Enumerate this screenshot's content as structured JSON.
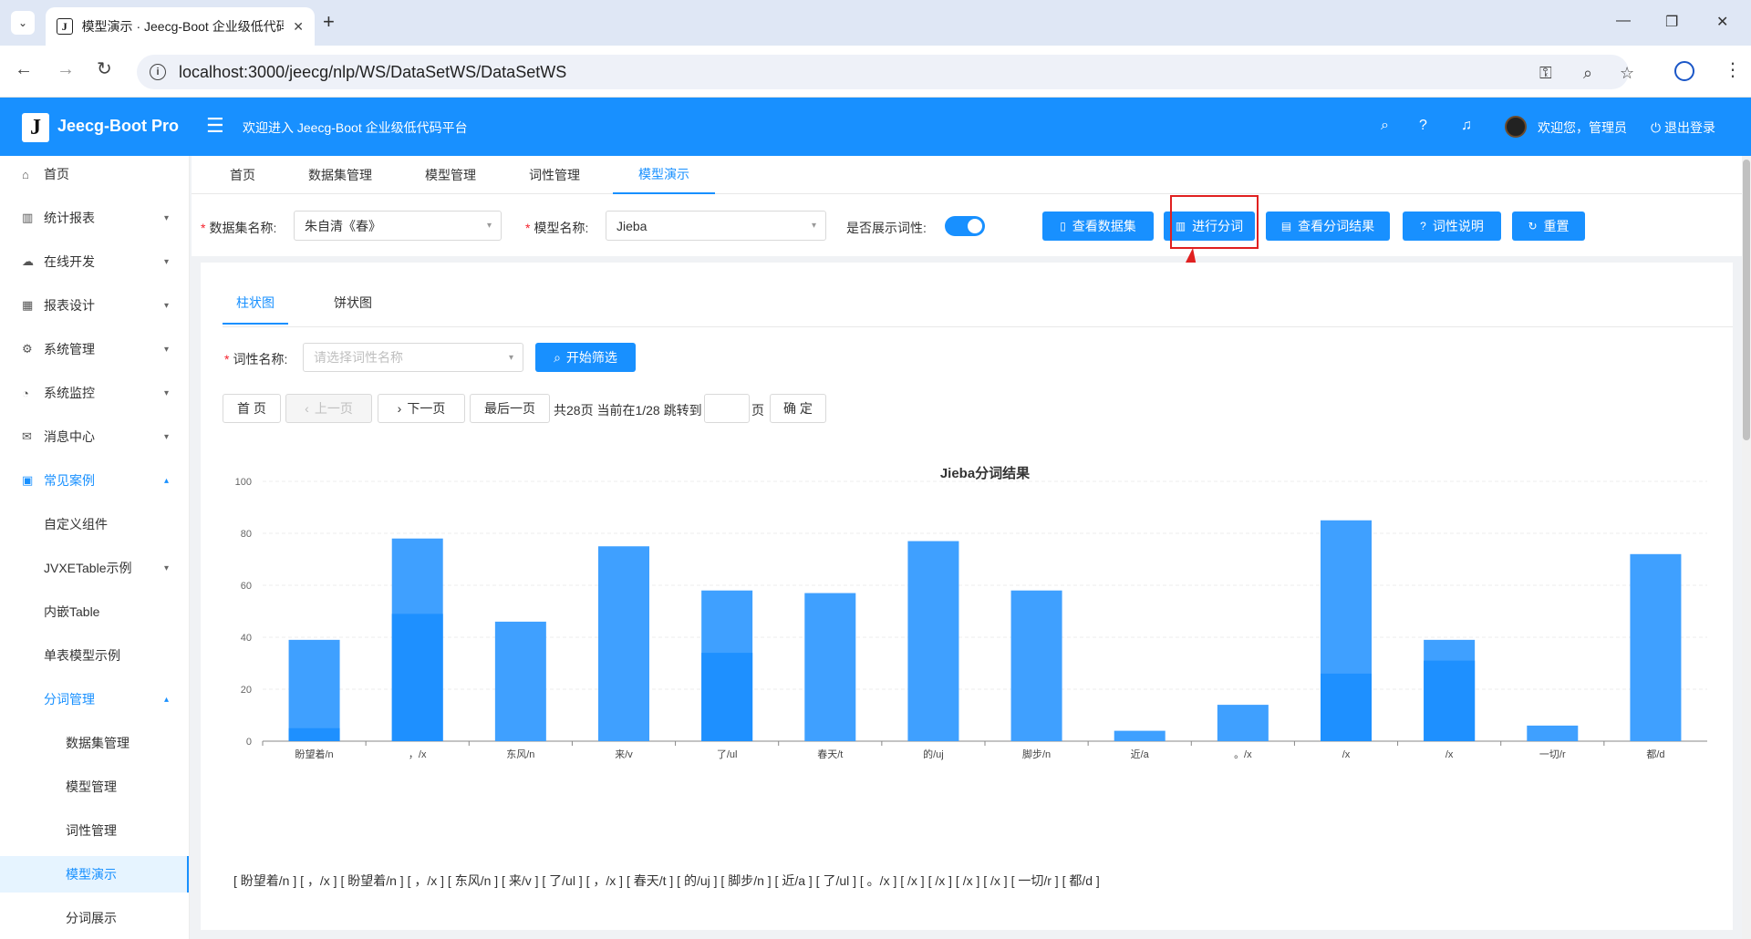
{
  "browser": {
    "tab_title": "模型演示 · Jeecg-Boot 企业级低代码平台",
    "url": "localhost:3000/jeecg/nlp/WS/DataSetWS/DataSetWS"
  },
  "header": {
    "logo_letter": "J",
    "app_name": "Jeecg-Boot Pro",
    "welcome": "欢迎进入 Jeecg-Boot 企业级低代码平台",
    "user_greeting": "欢迎您，管理员",
    "logout": "退出登录"
  },
  "sidebar": {
    "items": [
      {
        "icon": "⌂",
        "label": "首页"
      },
      {
        "icon": "▥",
        "label": "统计报表"
      },
      {
        "icon": "☁",
        "label": "在线开发"
      },
      {
        "icon": "▦",
        "label": "报表设计"
      },
      {
        "icon": "⚙",
        "label": "系统管理"
      },
      {
        "icon": "◔",
        "label": "系统监控"
      },
      {
        "icon": "✉",
        "label": "消息中心"
      },
      {
        "icon": "▣",
        "label": "常见案例"
      },
      {
        "label": "自定义组件"
      },
      {
        "label": "JVXETable示例"
      },
      {
        "label": "内嵌Table"
      },
      {
        "label": "单表模型示例"
      },
      {
        "label": "分词管理"
      },
      {
        "label": "数据集管理"
      },
      {
        "label": "模型管理"
      },
      {
        "label": "词性管理"
      },
      {
        "label": "模型演示"
      },
      {
        "label": "分词展示"
      }
    ]
  },
  "page_tabs": [
    "首页",
    "数据集管理",
    "模型管理",
    "词性管理",
    "模型演示"
  ],
  "form": {
    "dataset_label": "数据集名称:",
    "dataset_value": "朱自清《春》",
    "model_label": "模型名称:",
    "model_value": "Jieba",
    "show_pos_label": "是否展示词性:",
    "show_pos": true
  },
  "actions": [
    "查看数据集",
    "进行分词",
    "查看分词结果",
    "词性说明",
    "重置"
  ],
  "chart_tabs": [
    "柱状图",
    "饼状图"
  ],
  "filter": {
    "label": "词性名称:",
    "placeholder": "请选择词性名称",
    "button": "开始筛选"
  },
  "pagination": {
    "first": "首 页",
    "prev": "上一页",
    "next": "下一页",
    "last": "最后一页",
    "info": "共28页 当前在1/28 跳转到",
    "page_unit": "页",
    "confirm": "确 定"
  },
  "chart_data": {
    "type": "bar",
    "title": "Jieba分词结果",
    "categories": [
      "盼望着/n",
      "，/x",
      "东风/n",
      "来/v",
      "了/ul",
      "春天/t",
      "的/uj",
      "脚步/n",
      "近/a",
      "。/x",
      "/x",
      "/x",
      "一切/r",
      "都/d"
    ],
    "series": [
      {
        "values": [
          39,
          78,
          46,
          75,
          58,
          57,
          77,
          58,
          4,
          14,
          85,
          39,
          6,
          72
        ]
      },
      {
        "values": [
          5,
          49,
          0,
          0,
          34,
          0,
          0,
          0,
          0,
          0,
          26,
          31,
          0,
          0
        ]
      }
    ],
    "ylim": [
      0,
      100
    ],
    "yticks": [
      0,
      20,
      40,
      60,
      80,
      100
    ],
    "grid": true,
    "colors": [
      "#3fa0ff",
      "#1e90ff"
    ]
  },
  "result_text": "[ 盼望着/n ] [ ，/x ] [ 盼望着/n ] [ ，/x ] [ 东风/n ] [ 来/v ] [ 了/ul ] [ ，/x ] [ 春天/t ] [ 的/uj ] [ 脚步/n ] [ 近/a ] [ 了/ul ] [ 。/x ] [ /x ] [ /x ] [    /x ] [    /x ] [ 一切/r ] [ 都/d ]"
}
